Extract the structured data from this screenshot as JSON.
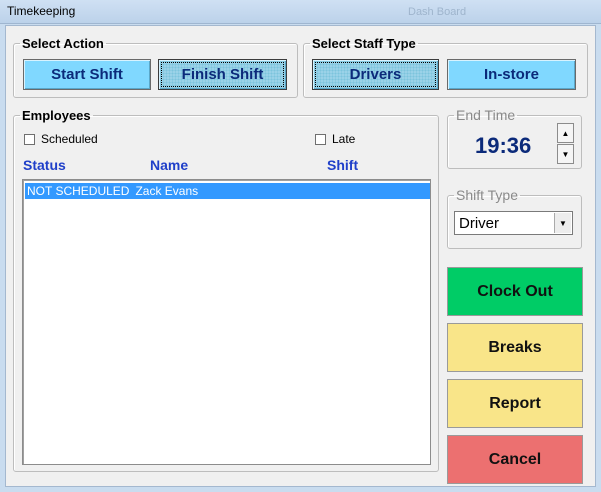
{
  "window": {
    "title": "Timekeeping",
    "ghost_text": "Dash Board"
  },
  "select_action": {
    "legend": "Select Action",
    "start_shift": "Start Shift",
    "finish_shift": "Finish Shift"
  },
  "staff_type": {
    "legend": "Select Staff Type",
    "drivers": "Drivers",
    "instore": "In-store"
  },
  "employees": {
    "legend": "Employees",
    "scheduled_label": "Scheduled",
    "late_label": "Late",
    "columns": {
      "status": "Status",
      "name": "Name",
      "shift": "Shift"
    },
    "rows": [
      {
        "status": "NOT SCHEDULED",
        "name": "Zack Evans",
        "shift": ""
      }
    ]
  },
  "end_time": {
    "legend": "End Time",
    "value": "19:36"
  },
  "shift_type": {
    "legend": "Shift Type",
    "selected": "Driver"
  },
  "actions": {
    "clock_out": "Clock Out",
    "breaks": "Breaks",
    "report": "Report",
    "cancel": "Cancel"
  },
  "colors": {
    "clock_out": "#00cc66",
    "breaks": "#f9e589",
    "report": "#f9e589",
    "cancel": "#ec7070",
    "action_button": "#80d8ff",
    "selection": "#3399ff"
  }
}
